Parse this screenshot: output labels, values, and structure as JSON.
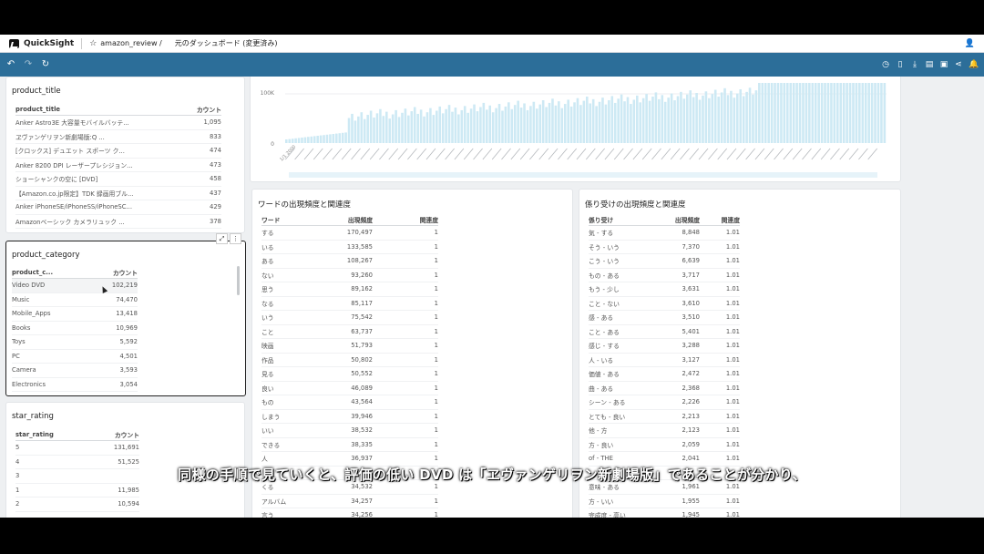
{
  "app": {
    "name": "QuickSight",
    "breadcrumb": "amazon_review /",
    "dashboard": "元のダッシュボード (変更済み)"
  },
  "colors": {
    "toolbar": "#2c6e99",
    "bar": "#cde9f4",
    "accent": "#2c6e99"
  },
  "product_title_panel": {
    "title": "product_title",
    "headers": [
      "product_title",
      "カウント"
    ],
    "rows": [
      [
        "Anker Astro3E 大容量モバイルバッテ...",
        "1,095"
      ],
      [
        "ヱヴァンゲリヲン新劇場版:Q ...",
        "833"
      ],
      [
        "[クロックス] デュエット スポーツ ク...",
        "474"
      ],
      [
        "Anker 8200 DPI レーザープレシジョン...",
        "473"
      ],
      [
        "ショーシャンクの空に [DVD]",
        "458"
      ],
      [
        "【Amazon.co.jp限定】TDK 録画用ブル...",
        "437"
      ],
      [
        "Anker iPhoneSE/iPhoneSS/iPhoneSC...",
        "429"
      ],
      [
        "Amazonベーシック カメラリュック ...",
        "378"
      ]
    ]
  },
  "product_category_panel": {
    "title": "product_category",
    "headers": [
      "product_c...",
      "カウント"
    ],
    "rows": [
      [
        "Video DVD",
        "102,219"
      ],
      [
        "Music",
        "74,470"
      ],
      [
        "Mobile_Apps",
        "13,418"
      ],
      [
        "Books",
        "10,969"
      ],
      [
        "Toys",
        "5,592"
      ],
      [
        "PC",
        "4,501"
      ],
      [
        "Camera",
        "3,593"
      ],
      [
        "Electronics",
        "3,054"
      ]
    ]
  },
  "star_rating_panel": {
    "title": "star_rating",
    "headers": [
      "star_rating",
      "カウント"
    ],
    "rows": [
      [
        "5",
        "131,691"
      ],
      [
        "4",
        "51,525"
      ],
      [
        "3",
        ""
      ],
      [
        "1",
        "11,985"
      ],
      [
        "2",
        "10,594"
      ]
    ]
  },
  "word_panel": {
    "title": "ワードの出現頻度と関連度",
    "headers": [
      "ワード",
      "出現頻度",
      "関連度"
    ],
    "rows": [
      [
        "する",
        "170,497",
        "1"
      ],
      [
        "いる",
        "133,585",
        "1"
      ],
      [
        "ある",
        "108,267",
        "1"
      ],
      [
        "ない",
        "93,260",
        "1"
      ],
      [
        "思う",
        "89,162",
        "1"
      ],
      [
        "なる",
        "85,117",
        "1"
      ],
      [
        "いう",
        "75,542",
        "1"
      ],
      [
        "こと",
        "63,737",
        "1"
      ],
      [
        "映画",
        "51,793",
        "1"
      ],
      [
        "作品",
        "50,802",
        "1"
      ],
      [
        "見る",
        "50,552",
        "1"
      ],
      [
        "良い",
        "46,089",
        "1"
      ],
      [
        "もの",
        "43,564",
        "1"
      ],
      [
        "しまう",
        "39,946",
        "1"
      ],
      [
        "いい",
        "38,532",
        "1"
      ],
      [
        "できる",
        "38,335",
        "1"
      ],
      [
        "人",
        "36,937",
        "1"
      ],
      [
        "",
        "",
        ""
      ],
      [
        "くる",
        "34,532",
        "1"
      ],
      [
        "アルバム",
        "34,257",
        "1"
      ],
      [
        "言う",
        "34,256",
        "1"
      ]
    ]
  },
  "dep_panel": {
    "title": "係り受けの出現頻度と関連度",
    "headers": [
      "係り受け",
      "出現頻度",
      "関連度"
    ],
    "rows": [
      [
        "気 - する",
        "8,848",
        "1.01"
      ],
      [
        "そう - いう",
        "7,370",
        "1.01"
      ],
      [
        "こう - いう",
        "6,639",
        "1.01"
      ],
      [
        "もの - ある",
        "3,717",
        "1.01"
      ],
      [
        "もう - 少し",
        "3,631",
        "1.01"
      ],
      [
        "こと - ない",
        "3,610",
        "1.01"
      ],
      [
        "感 - ある",
        "3,510",
        "1.01"
      ],
      [
        "こと - ある",
        "5,401",
        "1.01"
      ],
      [
        "感じ - する",
        "3,288",
        "1.01"
      ],
      [
        "人 - いる",
        "3,127",
        "1.01"
      ],
      [
        "価値 - ある",
        "2,472",
        "1.01"
      ],
      [
        "曲 - ある",
        "2,368",
        "1.01"
      ],
      [
        "シーン - ある",
        "2,226",
        "1.01"
      ],
      [
        "とても - 良い",
        "2,213",
        "1.01"
      ],
      [
        "他 - 方",
        "2,123",
        "1.01"
      ],
      [
        "方 - 良い",
        "2,059",
        "1.01"
      ],
      [
        "of - THE",
        "2,041",
        "1.01"
      ],
      [
        "",
        "",
        ""
      ],
      [
        "意味 - ある",
        "1,961",
        "1.01"
      ],
      [
        "方 - いい",
        "1,955",
        "1.01"
      ],
      [
        "完成度 - 高い",
        "1,945",
        "1.01"
      ]
    ]
  },
  "chart_data": {
    "type": "bar",
    "y_ticks": [
      "100K",
      "0"
    ],
    "ylim": [
      0,
      100000
    ],
    "x_start_label": "1/1 2000",
    "period": "monthly"
  },
  "subtitle": "同様の手順で見ていくと、評価の低い DVD は「ヱヴァンゲリヲン新劇場版」であることが分かり、"
}
